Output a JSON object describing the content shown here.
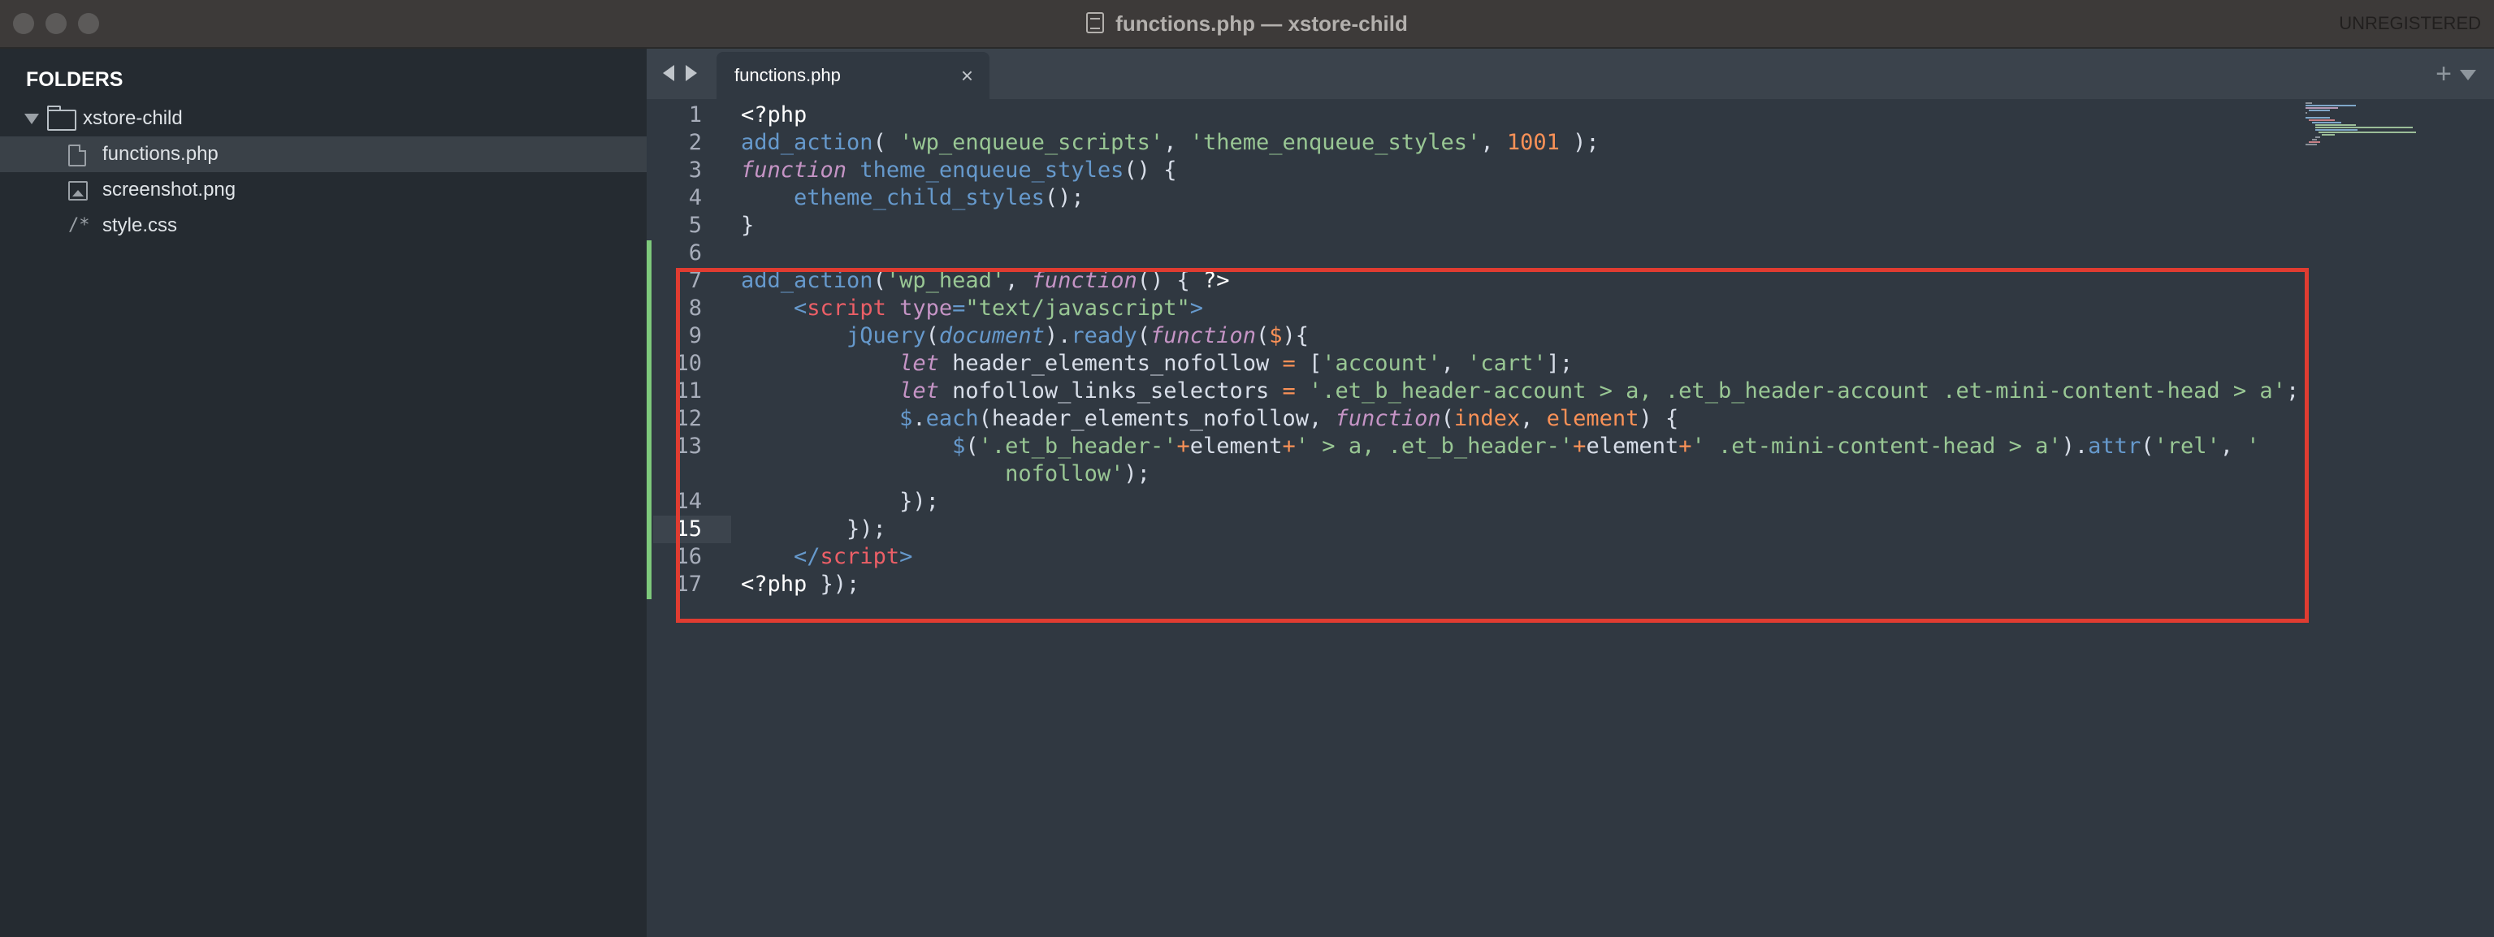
{
  "window": {
    "title": "functions.php — xstore-child",
    "status": "UNREGISTERED"
  },
  "sidebar": {
    "header": "FOLDERS",
    "folder": "xstore-child",
    "files": [
      "functions.php",
      "screenshot.png",
      "style.css"
    ],
    "selected_index": 0
  },
  "tabs": {
    "active": "functions.php"
  },
  "editor": {
    "current_line": 15,
    "line_numbers": [
      "1",
      "2",
      "3",
      "4",
      "5",
      "6",
      "7",
      "8",
      "9",
      "10",
      "11",
      "12",
      "13",
      "",
      "14",
      "15",
      "16",
      "17"
    ]
  },
  "colors": {
    "keyword": "#6699cc",
    "string": "#99c794",
    "number": "#f99157",
    "italic_keyword": "#c594c5",
    "tag": "#ec5f67",
    "highlight_box": "#e03c31",
    "modified_gutter": "#7ec97c"
  }
}
